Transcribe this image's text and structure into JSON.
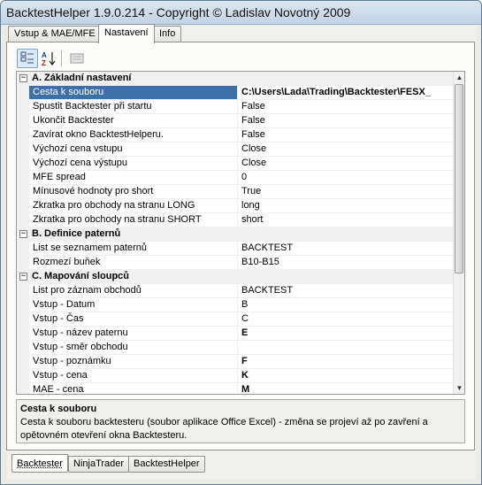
{
  "window": {
    "title": "BacktestHelper 1.9.0.214 - Copyright © Ladislav Novotný 2009"
  },
  "top_tabs": [
    {
      "label": "Vstup & MAE/MFE",
      "active": false
    },
    {
      "label": "Nastavení",
      "active": true
    },
    {
      "label": "Info",
      "active": false
    }
  ],
  "toolbar": {
    "categorized_icon": "categorized-view-icon",
    "alphabetical_icon": "alphabetical-sort-icon",
    "alphabetical_label": "A Z",
    "property_pages_icon": "property-pages-icon"
  },
  "grid": {
    "categories": [
      {
        "label": "A. Základní nastavení",
        "toggle": "−",
        "rows": [
          {
            "name": "Cesta k souboru",
            "value": "C:\\Users\\Lada\\Trading\\Backtester\\FESX_",
            "bold": true,
            "selected": true
          },
          {
            "name": "Spustit Backtester při startu",
            "value": "False"
          },
          {
            "name": "Ukončit Backtester",
            "value": "False"
          },
          {
            "name": "Zavírat okno BacktestHelperu.",
            "value": "False"
          },
          {
            "name": "Výchozí cena vstupu",
            "value": "Close"
          },
          {
            "name": "Výchozí cena výstupu",
            "value": "Close"
          },
          {
            "name": "MFE spread",
            "value": "0"
          },
          {
            "name": "Mínusové hodnoty pro short",
            "value": "True"
          },
          {
            "name": "Zkratka pro obchody na stranu LONG",
            "value": "long"
          },
          {
            "name": "Zkratka pro obchody na stranu SHORT",
            "value": "short"
          }
        ]
      },
      {
        "label": "B. Definice paternů",
        "toggle": "−",
        "rows": [
          {
            "name": "List se seznamem paternů",
            "value": "BACKTEST"
          },
          {
            "name": "Rozmezí buňek",
            "value": "B10-B15"
          }
        ]
      },
      {
        "label": "C. Mapování sloupců",
        "toggle": "−",
        "rows": [
          {
            "name": "List pro záznam obchodů",
            "value": "BACKTEST"
          },
          {
            "name": "Vstup - Datum",
            "value": "B"
          },
          {
            "name": "Vstup - Čas",
            "value": "C"
          },
          {
            "name": "Vstup - název paternu",
            "value": "E",
            "bold": true
          },
          {
            "name": "Vstup - směr obchodu",
            "value": ""
          },
          {
            "name": "Vstup - poznámku",
            "value": "F",
            "bold": true
          },
          {
            "name": "Vstup - cena",
            "value": "K",
            "bold": true
          },
          {
            "name": "MAE - cena",
            "value": "M",
            "bold": true
          }
        ]
      }
    ],
    "scroll_up": "▲",
    "scroll_down": "▼"
  },
  "description": {
    "title": "Cesta k souboru",
    "text": "Cesta k souboru backtesteru (soubor aplikace Office Excel) - změna se projeví až po zavření a opětovném otevření okna Backtesteru."
  },
  "bottom_tabs": [
    {
      "label": "Backtester",
      "active": true
    },
    {
      "label": "NinjaTrader",
      "active": false
    },
    {
      "label": "BacktestHelper",
      "active": false
    }
  ]
}
